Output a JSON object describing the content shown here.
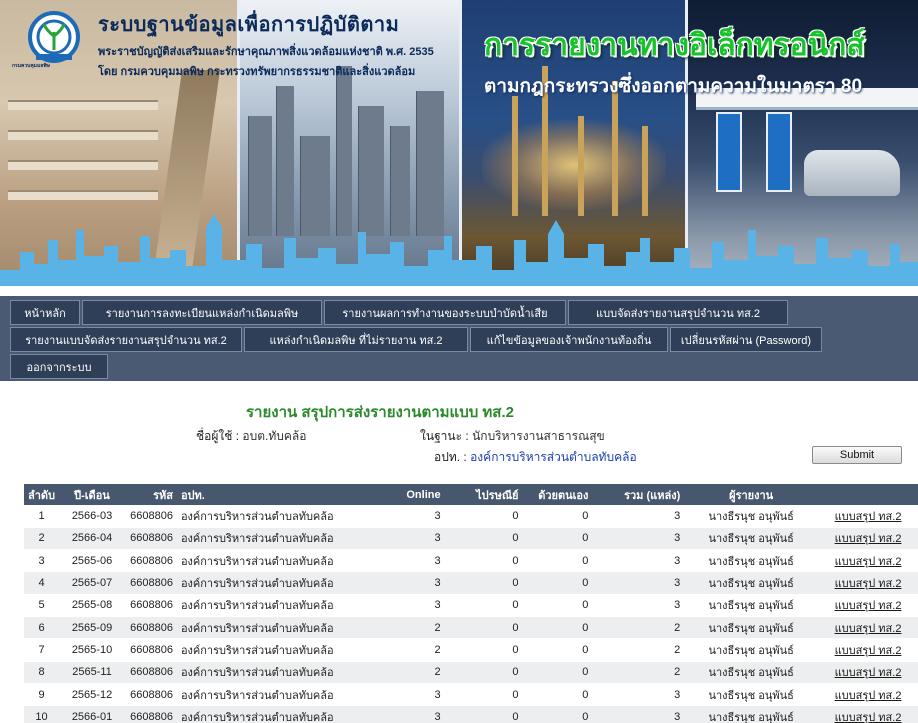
{
  "colors": {
    "nav_bg": "#4a5a72",
    "nav_button": "#2f3f57",
    "table_header": "#46576e",
    "report_title": "#2c8a2c",
    "link_blue": "#1a3fb0",
    "banner_green_title": "#17c22b"
  },
  "header": {
    "site_title": "ระบบฐานข้อมูลเพื่อการปฏิบัติตาม",
    "site_sub1": "พระราชบัญญัติส่งเสริมและรักษาคุณภาพสิ่งแวดล้อมแห่งชาติ พ.ศ. 2535",
    "site_sub2": "โดย กรมควบคุมมลพิษ กระทรวงทรัพยากรธรรมชาติและสิ่งแวดล้อม",
    "logo_caption": "กรมควบคุมมลพิษ",
    "main_title": "การรายงานทางอิเล็กทรอนิกส์",
    "main_subtitle": "ตามกฎกระทรวงซึ่งออกตามความในมาตรา 80"
  },
  "nav": {
    "row1": [
      "หน้าหลัก",
      "รายงานการลงทะเบียนแหล่งกำเนิดมลพิษ",
      "รายงานผลการทำงานของระบบบำบัดน้ำเสีย",
      "แบบจัดส่งรายงานสรุปจำนวน ทส.2"
    ],
    "row2": [
      "รายงานแบบจัดส่งรายงานสรุปจำนวน ทส.2",
      "แหล่งกำเนิดมลพิษ ที่ไม่รายงาน ทส.2",
      "แก้ไขข้อมูลของเจ้าพนักงานท้องถิ่น",
      "เปลี่ยนรหัสผ่าน (Password)"
    ],
    "row3": [
      "ออกจากระบบ"
    ]
  },
  "report": {
    "title": "รายงาน สรุปการส่งรายงานตามแบบ ทส.2",
    "user_label": "ชื่อผู้ใช้ :",
    "user_value": "อบต.ทับคล้อ",
    "role_label": "ในฐานะ :",
    "role_value": "นักบริหารงานสาธารณสุข",
    "apt_label": "อปท. :",
    "apt_value": "องค์การบริหารส่วนตำบลทับคล้อ",
    "submit_label": "Submit"
  },
  "table": {
    "headers": [
      "ลำดับ",
      "ปี-เดือน",
      "รหัส",
      "อปท.",
      "Online",
      "ไปรษณีย์",
      "ด้วยตนเอง",
      "รวม (แหล่ง)",
      "ผู้รายงาน",
      ""
    ],
    "rows": [
      {
        "no": "1",
        "ym": "2566-03",
        "code": "6608806",
        "org": "องค์การบริหารส่วนตำบลทับคล้อ",
        "online": "3",
        "post": "0",
        "self": "0",
        "total": "3",
        "reporter": "นางธีรนุช อนุพันธ์",
        "form": "แบบสรุป ทส.2"
      },
      {
        "no": "2",
        "ym": "2566-04",
        "code": "6608806",
        "org": "องค์การบริหารส่วนตำบลทับคล้อ",
        "online": "3",
        "post": "0",
        "self": "0",
        "total": "3",
        "reporter": "นางธีรนุช อนุพันธ์",
        "form": "แบบสรุป ทส.2"
      },
      {
        "no": "3",
        "ym": "2565-06",
        "code": "6608806",
        "org": "องค์การบริหารส่วนตำบลทับคล้อ",
        "online": "3",
        "post": "0",
        "self": "0",
        "total": "3",
        "reporter": "นางธีรนุช อนุพันธ์",
        "form": "แบบสรุป ทส.2"
      },
      {
        "no": "4",
        "ym": "2565-07",
        "code": "6608806",
        "org": "องค์การบริหารส่วนตำบลทับคล้อ",
        "online": "3",
        "post": "0",
        "self": "0",
        "total": "3",
        "reporter": "นางธีรนุช อนุพันธ์",
        "form": "แบบสรุป ทส.2"
      },
      {
        "no": "5",
        "ym": "2565-08",
        "code": "6608806",
        "org": "องค์การบริหารส่วนตำบลทับคล้อ",
        "online": "3",
        "post": "0",
        "self": "0",
        "total": "3",
        "reporter": "นางธีรนุช อนุพันธ์",
        "form": "แบบสรุป ทส.2"
      },
      {
        "no": "6",
        "ym": "2565-09",
        "code": "6608806",
        "org": "องค์การบริหารส่วนตำบลทับคล้อ",
        "online": "2",
        "post": "0",
        "self": "0",
        "total": "2",
        "reporter": "นางธีรนุช อนุพันธ์",
        "form": "แบบสรุป ทส.2"
      },
      {
        "no": "7",
        "ym": "2565-10",
        "code": "6608806",
        "org": "องค์การบริหารส่วนตำบลทับคล้อ",
        "online": "2",
        "post": "0",
        "self": "0",
        "total": "2",
        "reporter": "นางธีรนุช อนุพันธ์",
        "form": "แบบสรุป ทส.2"
      },
      {
        "no": "8",
        "ym": "2565-11",
        "code": "6608806",
        "org": "องค์การบริหารส่วนตำบลทับคล้อ",
        "online": "2",
        "post": "0",
        "self": "0",
        "total": "2",
        "reporter": "นางธีรนุช อนุพันธ์",
        "form": "แบบสรุป ทส.2"
      },
      {
        "no": "9",
        "ym": "2565-12",
        "code": "6608806",
        "org": "องค์การบริหารส่วนตำบลทับคล้อ",
        "online": "3",
        "post": "0",
        "self": "0",
        "total": "3",
        "reporter": "นางธีรนุช อนุพันธ์",
        "form": "แบบสรุป ทส.2"
      },
      {
        "no": "10",
        "ym": "2566-01",
        "code": "6608806",
        "org": "องค์การบริหารส่วนตำบลทับคล้อ",
        "online": "3",
        "post": "0",
        "self": "0",
        "total": "3",
        "reporter": "นางธีรนุช อนุพันธ์",
        "form": "แบบสรุป ทส.2"
      }
    ]
  }
}
